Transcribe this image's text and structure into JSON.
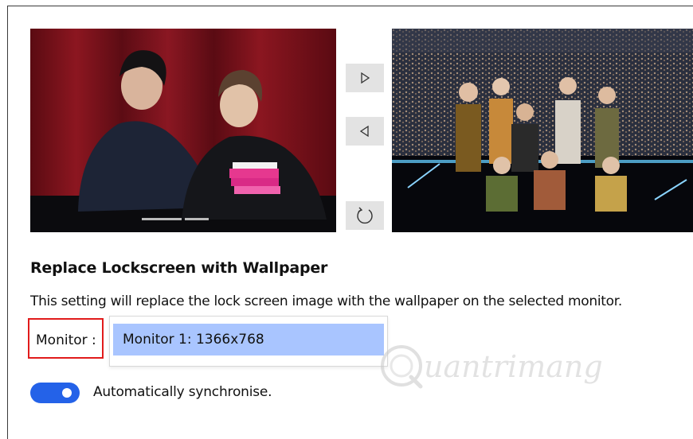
{
  "wallpaper_images": {
    "left": {
      "alt": "Two men at a fan event holding gifts"
    },
    "right": {
      "alt": "Group of performers posing on a concert stage"
    }
  },
  "controls": {
    "next_icon": "play-right-icon",
    "prev_icon": "play-left-icon",
    "refresh_icon": "refresh-icon"
  },
  "section": {
    "title": "Replace Lockscreen with Wallpaper",
    "description": "This setting will replace the lock screen image with the wallpaper on the selected monitor."
  },
  "monitor": {
    "label": "Monitor :",
    "selected": "Monitor 1: 1366x768"
  },
  "sync": {
    "label": "Automatically synchronise.",
    "enabled": true
  },
  "watermark": {
    "text": "uantrimang"
  },
  "colors": {
    "accent": "#2462e8",
    "selection": "#a9c5ff",
    "highlight_border": "#e11b1b",
    "button_bg": "#e3e3e3"
  }
}
